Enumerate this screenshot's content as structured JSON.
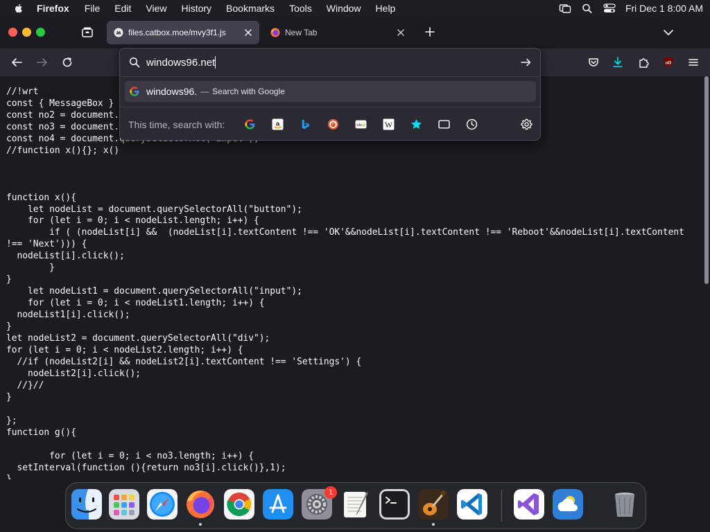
{
  "menubar": {
    "app_name": "Firefox",
    "items": [
      "File",
      "Edit",
      "View",
      "History",
      "Bookmarks",
      "Tools",
      "Window",
      "Help"
    ],
    "clock": "Fri Dec 1  8:00 AM"
  },
  "tabs": [
    {
      "title": "files.catbox.moe/mvy3f1.js",
      "active": true
    },
    {
      "title": "New Tab",
      "active": false
    }
  ],
  "urlbar": {
    "value": "windows96.net",
    "suggestion": {
      "text": "windows96.",
      "separator": "—",
      "action": "Search with Google"
    },
    "one_off_label": "This time, search with:",
    "engines": [
      "google-icon",
      "amazon-icon",
      "bing-icon",
      "duckduckgo-icon",
      "ebay-icon",
      "wikipedia-icon",
      "bookmarks-icon",
      "tabs-icon",
      "history-icon"
    ]
  },
  "page": {
    "code": "//!wrt\nconst { MessageBox }\nconst no2 = document.\nconst no3 = document.\nconst no4 = document.querySelectorAll(\"input\");\n//function x(){}; x()\n\n\n\nfunction x(){\n    let nodeList = document.querySelectorAll(\"button\");\n    for (let i = 0; i < nodeList.length; i++) {\n        if ( (nodeList[i] &&  (nodeList[i].textContent !== 'OK'&&nodeList[i].textContent !== 'Reboot'&&nodeList[i].textContent\n!== 'Next'))) {\n  nodeList[i].click();\n        }\n}\n    let nodeList1 = document.querySelectorAll(\"input\");\n    for (let i = 0; i < nodeList1.length; i++) {\n  nodeList1[i].click();\n}\nlet nodeList2 = document.querySelectorAll(\"div\");\nfor (let i = 0; i < nodeList2.length; i++) {\n  //if (nodeList2[i] && nodeList2[i].textContent !== 'Settings') {\n    nodeList2[i].click();\n  //}//\n}\n\n};\nfunction g(){\n\n        for (let i = 0; i < no3.length; i++) {\n  setInterval(function (){return no3[i].click()},1);\n}"
  },
  "dock": {
    "apps": [
      "finder",
      "launchpad",
      "safari",
      "firefox",
      "chrome",
      "app-store",
      "system-settings",
      "textedit",
      "terminal",
      "garageband",
      "vscode",
      "visual-studio",
      "weather",
      "trash"
    ],
    "settings_badge": "1"
  },
  "colors": {
    "chrome_bg": "#1c1b22",
    "toolbar_bg": "#2b2a33",
    "active_tab": "#42414d",
    "accent_blue": "#00ddff"
  }
}
